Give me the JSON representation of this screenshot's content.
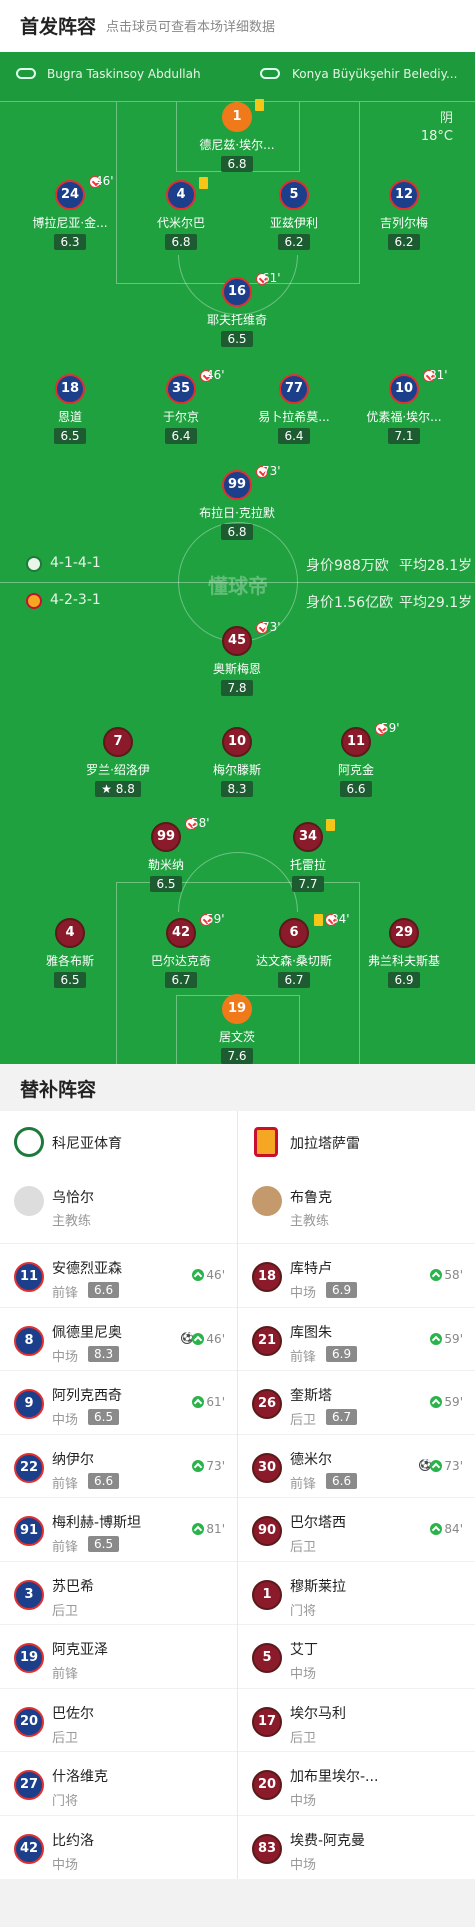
{
  "header": {
    "title": "首发阵容",
    "subtitle": "点击球员可查看本场详细数据"
  },
  "managers": {
    "home": "Bugra Taskinsoy Abdullah",
    "away": "Konya Büyükşehir Belediy..."
  },
  "weather": {
    "condition": "阴",
    "temp": "18°C"
  },
  "watermark": "懂球帝",
  "home_team": {
    "formation": "4-1-4-1",
    "value": "身价988万欧",
    "avg_age": "平均28.1岁"
  },
  "away_team": {
    "formation": "4-2-3-1",
    "value": "身价1.56亿欧",
    "avg_age": "平均29.1岁"
  },
  "home_players": [
    {
      "num": "1",
      "name": "德尼兹·埃尔...",
      "rating": "6.8"
    },
    {
      "num": "24",
      "name": "博拉尼亚·金...",
      "rating": "6.3",
      "sub": "46'"
    },
    {
      "num": "4",
      "name": "代米尔巴",
      "rating": "6.8"
    },
    {
      "num": "5",
      "name": "亚兹伊利",
      "rating": "6.2"
    },
    {
      "num": "12",
      "name": "吉列尔梅",
      "rating": "6.2"
    },
    {
      "num": "16",
      "name": "耶夫托维奇",
      "rating": "6.5",
      "sub": "61'"
    },
    {
      "num": "18",
      "name": "恩道",
      "rating": "6.5"
    },
    {
      "num": "35",
      "name": "于尔京",
      "rating": "6.4",
      "sub": "46'"
    },
    {
      "num": "77",
      "name": "易卜拉希莫...",
      "rating": "6.4"
    },
    {
      "num": "10",
      "name": "优素福·埃尔...",
      "rating": "7.1",
      "sub": "81'"
    },
    {
      "num": "99",
      "name": "布拉日·克拉默",
      "rating": "6.8",
      "sub": "73'"
    }
  ],
  "away_players": [
    {
      "num": "45",
      "name": "奥斯梅恩",
      "rating": "7.8",
      "sub": "73'"
    },
    {
      "num": "7",
      "name": "罗兰·绍洛伊",
      "rating": "8.8"
    },
    {
      "num": "10",
      "name": "梅尔滕斯",
      "rating": "8.3"
    },
    {
      "num": "11",
      "name": "阿克金",
      "rating": "6.6",
      "sub": "59'"
    },
    {
      "num": "99",
      "name": "勒米纳",
      "rating": "6.5",
      "sub": "58'"
    },
    {
      "num": "34",
      "name": "托雷拉",
      "rating": "7.7"
    },
    {
      "num": "4",
      "name": "雅各布斯",
      "rating": "6.5"
    },
    {
      "num": "42",
      "name": "巴尔达克奇",
      "rating": "6.7",
      "sub": "59'"
    },
    {
      "num": "6",
      "name": "达文森·桑切斯",
      "rating": "6.7",
      "sub": "84'"
    },
    {
      "num": "29",
      "name": "弗兰科夫斯基",
      "rating": "6.9"
    },
    {
      "num": "19",
      "name": "居文茨",
      "rating": "7.6"
    }
  ],
  "subs": {
    "title": "替补阵容",
    "home": {
      "team": "科尼亚体育",
      "coach": {
        "name": "乌恰尔",
        "role": "主教练"
      },
      "players": [
        {
          "num": "11",
          "name": "安德烈亚森",
          "pos": "前锋",
          "rating": "6.6",
          "in": "46'"
        },
        {
          "num": "8",
          "name": "佩德里尼奥",
          "pos": "中场",
          "rating": "8.3",
          "in": "46'"
        },
        {
          "num": "9",
          "name": "阿列克西奇",
          "pos": "中场",
          "rating": "6.5",
          "in": "61'"
        },
        {
          "num": "22",
          "name": "纳伊尔",
          "pos": "前锋",
          "rating": "6.6",
          "in": "73'"
        },
        {
          "num": "91",
          "name": "梅利赫-博斯坦",
          "pos": "前锋",
          "rating": "6.5",
          "in": "81'"
        },
        {
          "num": "3",
          "name": "苏巴希",
          "pos": "后卫"
        },
        {
          "num": "19",
          "name": "阿克亚泽",
          "pos": "前锋"
        },
        {
          "num": "20",
          "name": "巴佐尔",
          "pos": "后卫"
        },
        {
          "num": "27",
          "name": "什洛维克",
          "pos": "门将"
        },
        {
          "num": "42",
          "name": "比约洛",
          "pos": "中场"
        }
      ]
    },
    "away": {
      "team": "加拉塔萨雷",
      "coach": {
        "name": "布鲁克",
        "role": "主教练"
      },
      "players": [
        {
          "num": "18",
          "name": "库特卢",
          "pos": "中场",
          "rating": "6.9",
          "in": "58'"
        },
        {
          "num": "21",
          "name": "库图朱",
          "pos": "前锋",
          "rating": "6.9",
          "in": "59'"
        },
        {
          "num": "26",
          "name": "奎斯塔",
          "pos": "后卫",
          "rating": "6.7",
          "in": "59'"
        },
        {
          "num": "30",
          "name": "德米尔",
          "pos": "前锋",
          "rating": "6.6",
          "in": "73'"
        },
        {
          "num": "90",
          "name": "巴尔塔西",
          "pos": "后卫",
          "in": "84'"
        },
        {
          "num": "1",
          "name": "穆斯莱拉",
          "pos": "门将"
        },
        {
          "num": "5",
          "name": "艾丁",
          "pos": "中场"
        },
        {
          "num": "17",
          "name": "埃尔马利",
          "pos": "后卫"
        },
        {
          "num": "20",
          "name": "加布里埃尔-...",
          "pos": "中场"
        },
        {
          "num": "83",
          "name": "埃费-阿克曼",
          "pos": "中场"
        }
      ]
    }
  },
  "colors": {
    "pitch": "#1fa13f",
    "home": "#1c3f8c",
    "away": "#8b1a2a",
    "gk_home": "#f07a1a"
  }
}
